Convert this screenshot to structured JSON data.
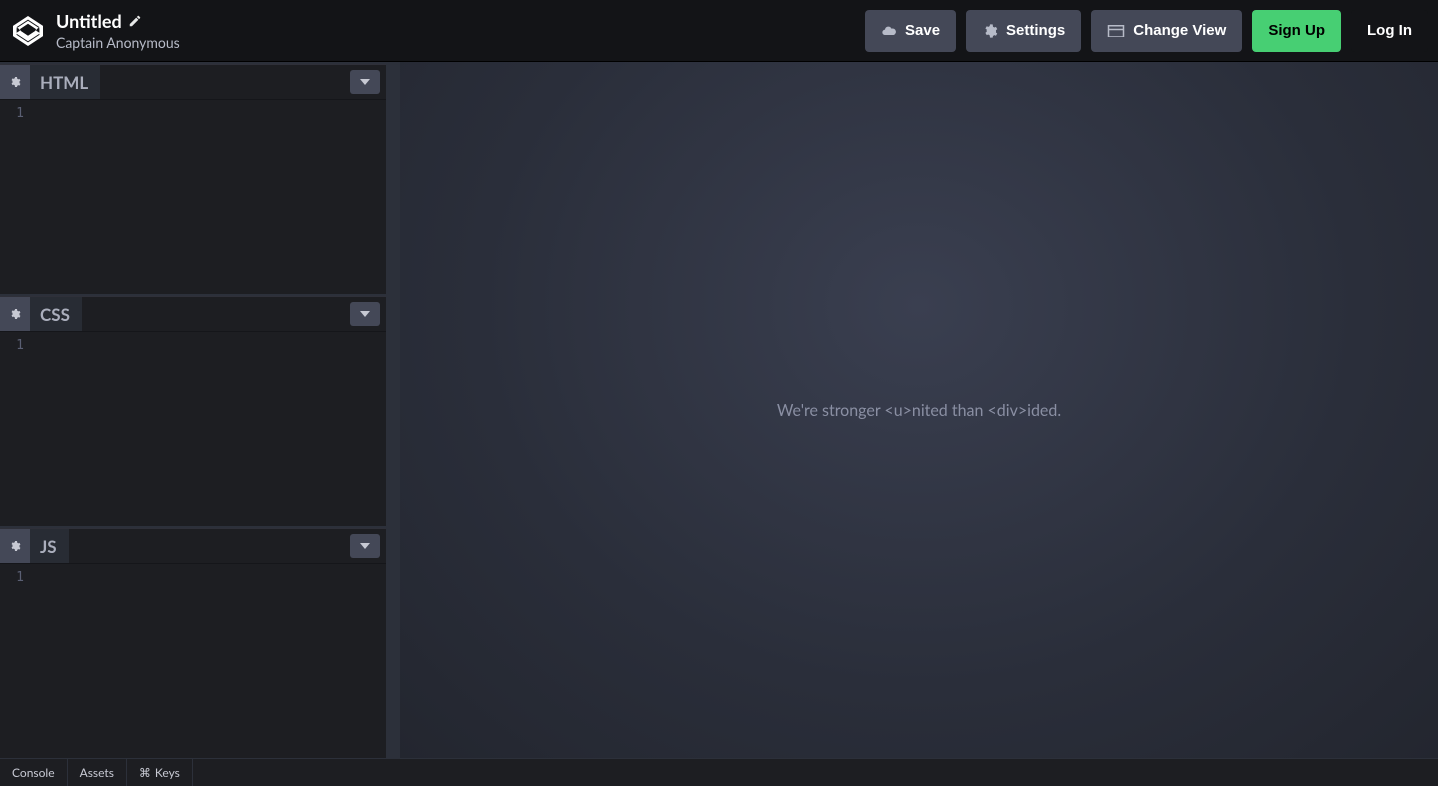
{
  "header": {
    "title": "Untitled",
    "author": "Captain Anonymous",
    "buttons": {
      "save": "Save",
      "settings": "Settings",
      "changeView": "Change View",
      "signUp": "Sign Up",
      "logIn": "Log In"
    }
  },
  "editors": {
    "panes": [
      {
        "title": "HTML",
        "lineStart": "1"
      },
      {
        "title": "CSS",
        "lineStart": "1"
      },
      {
        "title": "JS",
        "lineStart": "1"
      }
    ]
  },
  "preview": {
    "message": "We're stronger <u>nited than <div>ided."
  },
  "footer": {
    "console": "Console",
    "assets": "Assets",
    "keys": "Keys",
    "keysPrefix": "⌘"
  }
}
